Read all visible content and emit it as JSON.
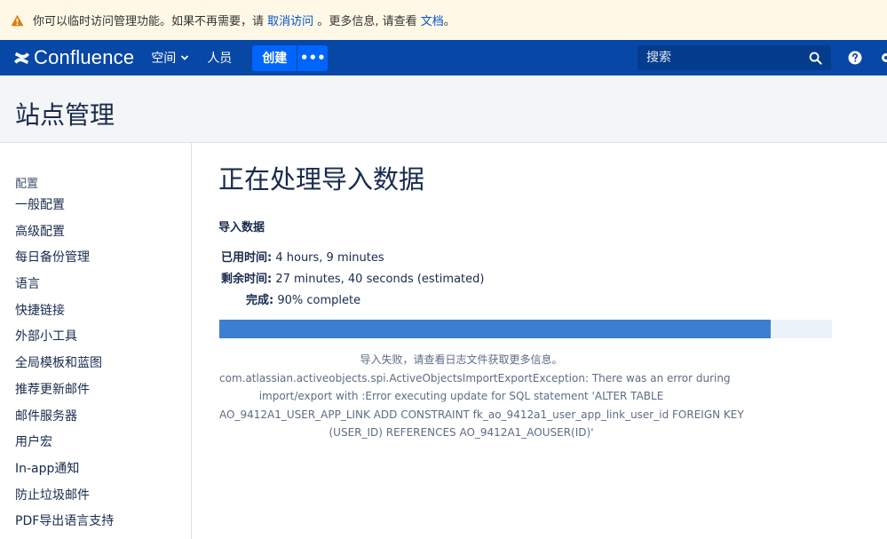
{
  "banner": {
    "text_prefix": "你可以临时访问管理功能。如果不再需要，请",
    "revoke_link": "取消访问",
    "text_middle": "。更多信息, 请查看",
    "docs_link": "文档",
    "text_suffix": "。"
  },
  "nav": {
    "logo": "Confluence",
    "spaces": "空间",
    "people": "人员",
    "create": "创建",
    "more": "•••",
    "search_placeholder": "搜索"
  },
  "header": {
    "title": "站点管理"
  },
  "sidebar": {
    "heading": "配置",
    "items": [
      {
        "label": "一般配置"
      },
      {
        "label": "高级配置"
      },
      {
        "label": "每日备份管理"
      },
      {
        "label": "语言"
      },
      {
        "label": "快捷链接"
      },
      {
        "label": "外部小工具"
      },
      {
        "label": "全局模板和蓝图"
      },
      {
        "label": "推荐更新邮件"
      },
      {
        "label": "邮件服务器"
      },
      {
        "label": "用户宏"
      },
      {
        "label": "In-app通知"
      },
      {
        "label": "防止垃圾邮件"
      },
      {
        "label": "PDF导出语言支持"
      }
    ]
  },
  "main": {
    "title": "正在处理导入数据",
    "section": "导入数据",
    "elapsed_label": "已用时间:",
    "elapsed_value": "4 hours, 9 minutes",
    "remaining_label": "剩余时间:",
    "remaining_value": "27 minutes, 40 seconds (estimated)",
    "complete_label": "完成:",
    "complete_value": "90% complete",
    "progress_percent": 90,
    "error_lines": [
      "导入失败，请查看日志文件获取更多信息。",
      "com.atlassian.activeobjects.spi.ActiveObjectsImportExportException: There was an error during",
      "import/export with :Error executing update for SQL statement 'ALTER TABLE",
      "AO_9412A1_USER_APP_LINK ADD CONSTRAINT fk_ao_9412a1_user_app_link_user_id FOREIGN KEY",
      "(USER_ID) REFERENCES AO_9412A1_AOUSER(ID)'"
    ]
  },
  "colors": {
    "nav_bg": "#0747a6",
    "create_button": "#0065ff",
    "progress_fill": "#3b7fd0",
    "banner_bg": "#fff8e6",
    "warning_icon": "#de7c0c"
  },
  "icons": [
    "warning-icon",
    "confluence-logo-icon",
    "chevron-down-icon",
    "search-icon",
    "help-icon",
    "gear-icon"
  ]
}
